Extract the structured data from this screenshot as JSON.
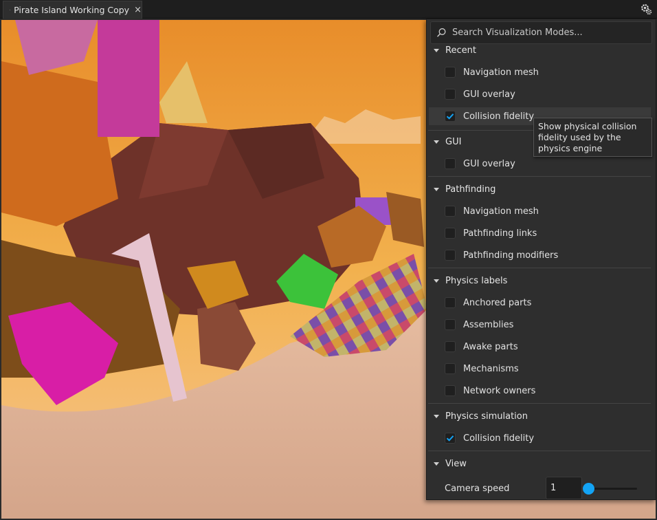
{
  "tab": {
    "title": "Pirate Island Working Copy",
    "close": "×"
  },
  "toolbar": {
    "settings_icon": "gear-icon"
  },
  "search": {
    "placeholder": "Search Visualization Modes...",
    "value": ""
  },
  "sections": {
    "recent": {
      "title": "Recent",
      "items": [
        {
          "label": "Navigation mesh",
          "checked": false
        },
        {
          "label": "GUI overlay",
          "checked": false
        },
        {
          "label": "Collision fidelity",
          "checked": true
        }
      ]
    },
    "gui": {
      "title": "GUI",
      "items": [
        {
          "label": "GUI overlay",
          "checked": false
        }
      ]
    },
    "pathfinding": {
      "title": "Pathfinding",
      "items": [
        {
          "label": "Navigation mesh",
          "checked": false
        },
        {
          "label": "Pathfinding links",
          "checked": false
        },
        {
          "label": "Pathfinding modifiers",
          "checked": false
        }
      ]
    },
    "physics_labels": {
      "title": "Physics labels",
      "items": [
        {
          "label": "Anchored parts",
          "checked": false
        },
        {
          "label": "Assemblies",
          "checked": false
        },
        {
          "label": "Awake parts",
          "checked": false
        },
        {
          "label": "Mechanisms",
          "checked": false
        },
        {
          "label": "Network owners",
          "checked": false
        }
      ]
    },
    "physics_simulation": {
      "title": "Physics simulation",
      "items": [
        {
          "label": "Collision fidelity",
          "checked": true
        }
      ]
    },
    "view": {
      "title": "View",
      "camera_speed_label": "Camera speed",
      "camera_speed_value": "1"
    }
  },
  "tooltip": {
    "text": "Show physical collision fidelity used by the physics engine"
  },
  "colors": {
    "accent": "#13a3f4",
    "panel_bg": "#2e2e2e",
    "highlight_row": "#3a3a3a"
  }
}
